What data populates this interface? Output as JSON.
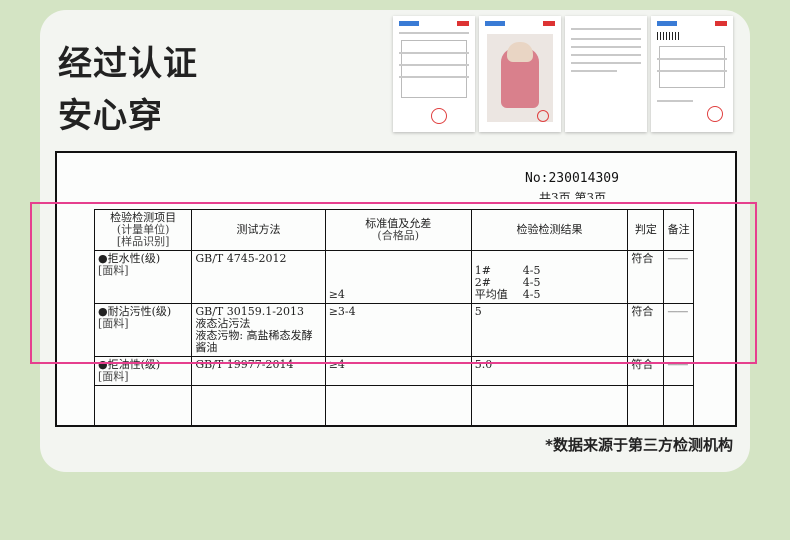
{
  "headline": {
    "line1": "经过认证",
    "line2": "安心穿"
  },
  "thumbnails": [
    {
      "kind": "report-page"
    },
    {
      "kind": "product-photo"
    },
    {
      "kind": "text-page"
    },
    {
      "kind": "report-page-barcode"
    }
  ],
  "report": {
    "number": "No:230014309",
    "page": "共3页  第3页",
    "headers": {
      "item": "检验检测项目",
      "item_unit": "(计量单位)",
      "item_sample": "[样品识别]",
      "method": "测试方法",
      "standard": "标准值及允差",
      "standard_sub": "(合格品)",
      "result": "检验检测结果",
      "verdict": "判定",
      "note": "备注"
    },
    "rows": [
      {
        "item": "●拒水性(级)",
        "sample": "[面料]",
        "method": "GB/T 4745-2012",
        "method_extra": "",
        "standard": "≥4",
        "results": [
          {
            "k": "1#",
            "v": "4-5"
          },
          {
            "k": "2#",
            "v": "4-5"
          },
          {
            "k": "平均值",
            "v": "4-5"
          }
        ],
        "verdict": "符合",
        "note": "——"
      },
      {
        "item": "●耐沾污性(级)",
        "sample": "[面料]",
        "method": "GB/T 30159.1-2013",
        "method_extra": "液态沾污法",
        "method_extra2": "液态污物: 高盐稀态发酵酱油",
        "standard": "≥3-4",
        "result": "5",
        "verdict": "符合",
        "note": "——"
      },
      {
        "item": "●拒油性(级)",
        "sample": "[面料]",
        "method": "GB/T 19977-2014",
        "standard": "≥4",
        "result": "5.0",
        "verdict": "符合",
        "note": "——"
      }
    ]
  },
  "footnote": "*数据来源于第三方检测机构",
  "colors": {
    "background": "#d4e4c4",
    "card": "#f3f5f1",
    "highlight": "#e63f8e"
  }
}
